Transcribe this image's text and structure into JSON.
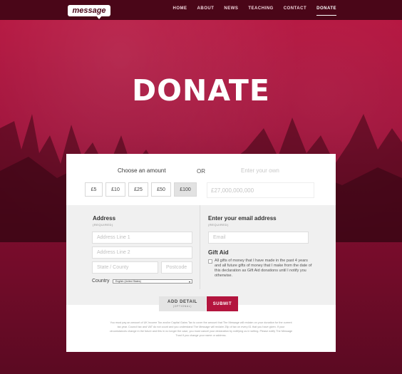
{
  "brand": {
    "logo_text": "message"
  },
  "nav": {
    "items": [
      "HOME",
      "ABOUT",
      "NEWS",
      "TEACHING",
      "CONTACT",
      "DONATE"
    ],
    "active": "DONATE"
  },
  "hero": {
    "title": "DONATE"
  },
  "amount": {
    "choose_label": "Choose an amount",
    "or_label": "OR",
    "own_label": "Enter your own",
    "own_placeholder": "£27,000,000,000",
    "options": [
      "£5",
      "£10",
      "£25",
      "£50",
      "£100"
    ],
    "selected": "£100"
  },
  "address": {
    "title": "Address",
    "required": "(REQUIRED)",
    "line1_placeholder": "Address Line 1",
    "line2_placeholder": "Address Line 2",
    "state_placeholder": "State / County",
    "postcode_placeholder": "Postcode",
    "country_label": "Country",
    "country_value": "English (United States)"
  },
  "email": {
    "title": "Enter your email address",
    "required": "(REQUIRED)",
    "placeholder": "Email"
  },
  "gift_aid": {
    "title": "Gift Aid",
    "text": "All gifts of money that I have made in the past 4 years and all future gifts of money that I make from the date of this declaration as Gift Aid donations until I notify you otherwise."
  },
  "buttons": {
    "add_detail": "ADD DETAIL",
    "add_detail_sub": "(OPTIONAL)",
    "submit": "SUBMIT"
  },
  "disclaimer": "You must pay an amount of UK Income Tax and/or Capital Gains Tax to cover the amount that The Message will reclaim on your donation for the current tax year. Council tax and VAT do not count and you understand The Message will reclaim 25p of tax on every £1 that you have given. If your circumstances change in the future and this in no longer the case, you must cancel your declaration by notifying us in writing. Please notify The Message Trust if you change your name or address.",
  "colors": {
    "accent": "#b3153e",
    "topbar": "#4a0618"
  }
}
